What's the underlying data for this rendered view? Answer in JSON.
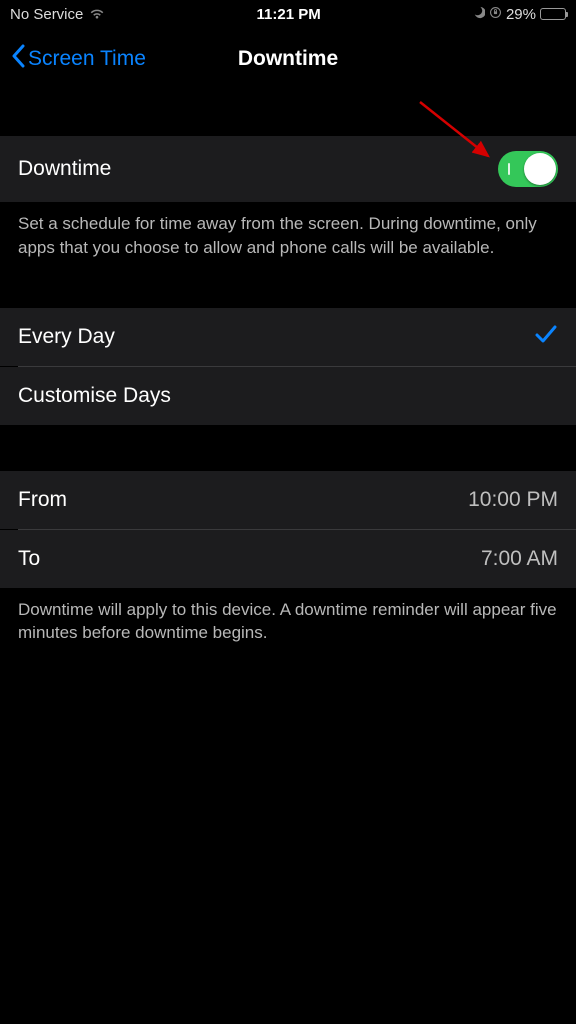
{
  "status": {
    "service": "No Service",
    "time": "11:21 PM",
    "battery_pct": "29%"
  },
  "nav": {
    "back_label": "Screen Time",
    "title": "Downtime"
  },
  "toggle_section": {
    "label": "Downtime",
    "on": true,
    "description": "Set a schedule for time away from the screen. During downtime, only apps that you choose to allow and phone calls will be available."
  },
  "schedule_mode": {
    "every_day": "Every Day",
    "every_day_selected": true,
    "customise": "Customise Days"
  },
  "times": {
    "from_label": "From",
    "from_value": "10:00 PM",
    "to_label": "To",
    "to_value": "7:00 AM"
  },
  "footer": "Downtime will apply to this device. A downtime reminder will appear five minutes before downtime begins.",
  "colors": {
    "accent": "#0a84ff",
    "toggle_on": "#34c759",
    "battery_low": "#ffcc00"
  }
}
